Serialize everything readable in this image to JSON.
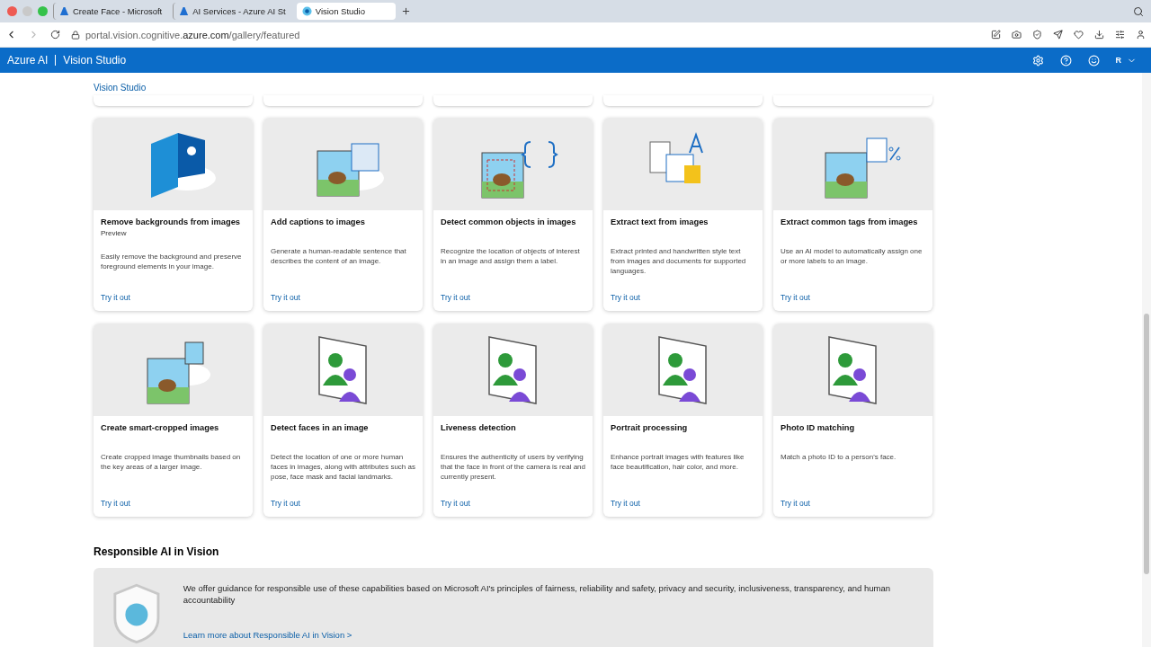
{
  "browser": {
    "tabs": [
      {
        "title": "Create Face - Microsoft",
        "selected": false
      },
      {
        "title": "AI Services - Azure AI St",
        "selected": false
      },
      {
        "title": "Vision Studio",
        "selected": true
      }
    ],
    "url_host": "portal.vision.cognitive.",
    "url_domain": "azure.com",
    "url_path": "/gallery/featured"
  },
  "app_header": {
    "brand": "Azure AI",
    "product": "Vision Studio",
    "user_initial": "R"
  },
  "breadcrumb": "Vision Studio",
  "cards": [
    {
      "title": "Remove backgrounds from images",
      "badge": "Preview",
      "description": "Easily remove the background and preserve foreground elements in your image.",
      "link": "Try it out",
      "kind": "background"
    },
    {
      "title": "Add captions to images",
      "description": "Generate a human-readable sentence that describes the content of an image.",
      "link": "Try it out",
      "kind": "caption"
    },
    {
      "title": "Detect common objects in images",
      "description": "Recognize the location of objects of interest in an image and assign them a label.",
      "link": "Try it out",
      "kind": "objects"
    },
    {
      "title": "Extract text from images",
      "description": "Extract printed and handwritten style text from images and documents for supported languages.",
      "link": "Try it out",
      "kind": "text"
    },
    {
      "title": "Extract common tags from images",
      "description": "Use an AI model to automatically assign one or more labels to an image.",
      "link": "Try it out",
      "kind": "tags"
    },
    {
      "title": "Create smart-cropped images",
      "description": "Create cropped image thumbnails based on the key areas of a larger image.",
      "link": "Try it out",
      "kind": "crop"
    },
    {
      "title": "Detect faces in an image",
      "description": "Detect the location of one or more human faces in images, along with attributes such as pose, face mask and facial landmarks.",
      "link": "Try it out",
      "kind": "face"
    },
    {
      "title": "Liveness detection",
      "description": "Ensures the authenticity of users by verifying that the face in front of the camera is real and currently present.",
      "link": "Try it out",
      "kind": "face"
    },
    {
      "title": "Portrait processing",
      "description": "Enhance portrait images with features like face beautification, hair color, and more.",
      "link": "Try it out",
      "kind": "face"
    },
    {
      "title": "Photo ID matching",
      "description": "Match a photo ID to a person's face.",
      "link": "Try it out",
      "kind": "face"
    }
  ],
  "responsible": {
    "heading": "Responsible AI in Vision",
    "text": "We offer guidance for responsible use of these capabilities based on Microsoft AI's principles of fairness, reliability and safety, privacy and security, inclusiveness, transparency, and human accountability",
    "link": "Learn more about Responsible AI in Vision >"
  }
}
